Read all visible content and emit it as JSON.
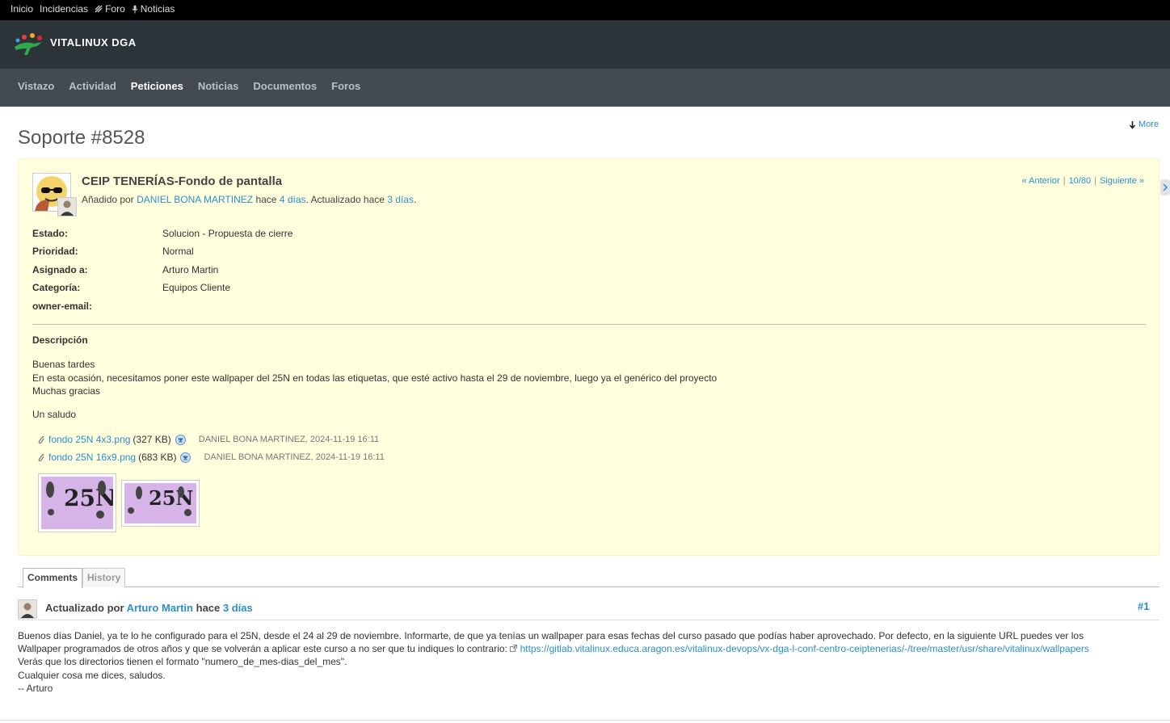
{
  "top_menu": {
    "items": [
      {
        "label": "Inicio",
        "icon": ""
      },
      {
        "label": "Incidencias",
        "icon": ""
      },
      {
        "label": "Foro",
        "icon": "forum-icon"
      },
      {
        "label": "Noticias",
        "icon": "microphone-icon"
      }
    ]
  },
  "header": {
    "title": "VITALINUX DGA"
  },
  "main_menu": {
    "tabs": [
      "Vistazo",
      "Actividad",
      "Peticiones",
      "Noticias",
      "Documentos",
      "Foros"
    ],
    "selected": "Peticiones"
  },
  "more_link": "More",
  "page_title": "Soporte #8528",
  "issue": {
    "subject": "CEIP TENERÍAS-Fondo de pantalla",
    "added_by_prefix": "Añadido por",
    "author": "DANIEL BONA MARTINEZ",
    "ago1_prefix": "hace",
    "created_ago": "4 días",
    "updated_prefix": ". Actualizado hace",
    "updated_ago": "3 días",
    "end_dot": ".",
    "nav": {
      "prev": "« Anterior",
      "position": "10/80",
      "next": "Siguiente »"
    },
    "attributes": [
      {
        "label": "Estado:",
        "value": "Solucion - Propuesta de cierre",
        "link": false
      },
      {
        "label": "Prioridad:",
        "value": "Normal",
        "link": false
      },
      {
        "label": "Asignado a:",
        "value": "Arturo Martin",
        "link": true
      },
      {
        "label": "Categoría:",
        "value": "Equipos Cliente",
        "link": false
      },
      {
        "label": "owner-email:",
        "value": "",
        "link": false
      }
    ],
    "description_title": "Descripción",
    "description": [
      "Buenas tardes",
      "En esta ocasión, necesitamos poner este wallpaper del 25N en todas las etiquetas, que esté activo hasta el 29 de noviembre, luego ya el genérico del proyecto",
      "Muchas gracias",
      "",
      "Un saludo"
    ],
    "attachments": [
      {
        "name": "fondo 25N 4x3.png",
        "size": "(327 KB)",
        "author": "DANIEL BONA MARTINEZ, 2024-11-19 16:11"
      },
      {
        "name": "fondo 25N 16x9.png",
        "size": "(683 KB)",
        "author": "DANIEL BONA MARTINEZ, 2024-11-19 16:11"
      }
    ],
    "thumbnail_text": "25N"
  },
  "tabs": {
    "comments": "Comments",
    "history": "History"
  },
  "journal": {
    "prefix": "Actualizado por",
    "user": "Arturo Martin",
    "ago_prefix": "hace",
    "ago": "3 días",
    "number": "#1",
    "line1": "Buenos días Daniel, ya te lo he configurado para el 25N, desde el 24 al 29 de noviembre. Informarte, de que ya tenías un wallpaper para esas fechas del curso pasado que podías haber aprovechado. Por defecto, en la siguiente URL puedes ver los",
    "line2": "Wallpaper programados de otros años y que se volverán a aplicar este curso a no ser que tu indiques lo contrario:",
    "url": "https://gitlab.vitalinux.educa.aragon.es/vitalinux-devops/vx-dga-l-conf-centro-ceiptenerias/-/tree/master/usr/share/vitalinux/wallpapers",
    "line3": "Verás que los directorios tienen el formato \"numero_de_mes-dias_del_mes\".",
    "line4": "Cualquier cosa me dices, saludos.",
    "line5": "-- Arturo"
  }
}
